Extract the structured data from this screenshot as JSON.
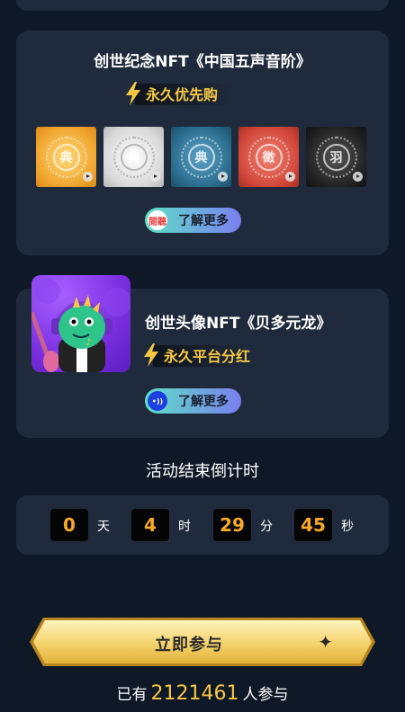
{
  "card1": {
    "title": "创世纪念NFT《中国五声音阶》",
    "perk": "永久优先购",
    "thumbs": [
      {
        "glyph": "典",
        "color": "#f0a52e"
      },
      {
        "glyph": "典",
        "color": "#d8d8d8"
      },
      {
        "glyph": "典",
        "color": "#2a6c8e"
      },
      {
        "glyph": "徵",
        "color": "#d2473a"
      },
      {
        "glyph": "羽",
        "color": "#222222"
      }
    ],
    "learn_more": "了解更多",
    "learn_icon": "閱聽"
  },
  "card2": {
    "title": "创世头像NFT《贝多元龙》",
    "perk": "永久平台分红",
    "learn_more": "了解更多",
    "learn_icon": "•))"
  },
  "countdown": {
    "title": "活动结束倒计时",
    "days": "0",
    "days_unit": "天",
    "hours": "4",
    "hours_unit": "时",
    "minutes": "29",
    "minutes_unit": "分",
    "seconds": "45",
    "seconds_unit": "秒"
  },
  "join": {
    "label": "立即参与",
    "star": "✦"
  },
  "participants": {
    "prefix": "已有",
    "count": "2121461",
    "suffix": "人参与"
  },
  "colors": {
    "background": "#0f1827",
    "card": "#1f2b3c",
    "accent_gold": "#f7c744",
    "countdown_digit": "#f7a928"
  }
}
